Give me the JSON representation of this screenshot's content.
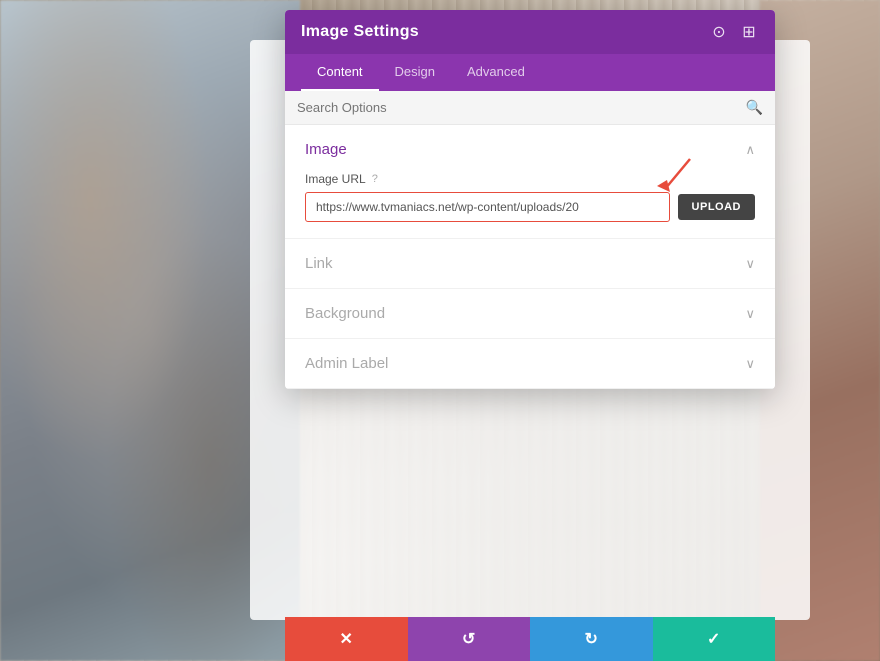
{
  "header": {
    "title": "Image Settings",
    "icon_target": "⊙",
    "icon_layout": "⊞"
  },
  "tabs": [
    {
      "id": "content",
      "label": "Content",
      "active": true
    },
    {
      "id": "design",
      "label": "Design",
      "active": false
    },
    {
      "id": "advanced",
      "label": "Advanced",
      "active": false
    }
  ],
  "search": {
    "placeholder": "Search Options",
    "icon": "🔍"
  },
  "sections": [
    {
      "id": "image",
      "title": "Image",
      "color": "purple",
      "expanded": true,
      "chevron": "∧",
      "fields": [
        {
          "id": "image-url",
          "label": "Image URL",
          "help": "?",
          "value": "https://www.tvmaniacs.net/wp-content/uploads/20",
          "upload_label": "UPLOAD"
        }
      ]
    },
    {
      "id": "link",
      "title": "Link",
      "color": "gray",
      "expanded": false,
      "chevron": "∨"
    },
    {
      "id": "background",
      "title": "Background",
      "color": "gray",
      "expanded": false,
      "chevron": "∨"
    },
    {
      "id": "admin-label",
      "title": "Admin Label",
      "color": "gray",
      "expanded": false,
      "chevron": "∨"
    }
  ],
  "bottom_bar": [
    {
      "id": "cancel",
      "label": "✕",
      "color": "#e74c3c"
    },
    {
      "id": "undo",
      "label": "↺",
      "color": "#8e44ad"
    },
    {
      "id": "redo",
      "label": "↻",
      "color": "#3498db"
    },
    {
      "id": "save",
      "label": "✓",
      "color": "#1abc9c"
    }
  ]
}
